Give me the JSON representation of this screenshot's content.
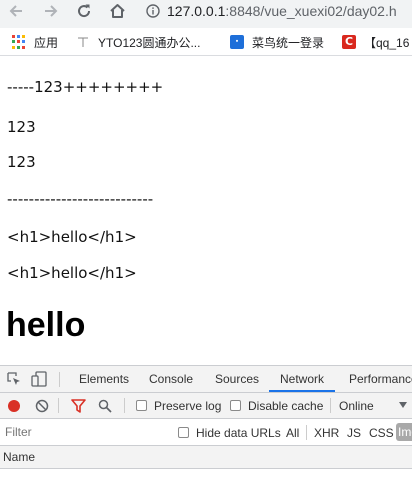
{
  "browser": {
    "url_host": "127.0.0.1",
    "url_path": ":8848/vue_xuexi02/day02.h",
    "bookmarks": [
      {
        "label": "应用",
        "icon": "apps-grid-icon"
      },
      {
        "label": "YTO123圆通办公...",
        "icon": "yto-icon"
      },
      {
        "label": "菜鸟统一登录",
        "icon": "cainiao-icon"
      },
      {
        "label": "【qq_16",
        "icon": "csdn-icon"
      }
    ]
  },
  "page": {
    "lines": [
      "-----123++++++++",
      "123",
      "123",
      "---------------------------",
      "<h1>hello</h1>",
      "<h1>hello</h1>"
    ],
    "heading": "hello"
  },
  "devtools": {
    "tabs": [
      "Elements",
      "Console",
      "Sources",
      "Network",
      "Performance"
    ],
    "active_tab": "Network",
    "toolbar": {
      "preserve_log": "Preserve log",
      "disable_cache": "Disable cache",
      "throttling": "Online"
    },
    "filter": {
      "placeholder": "Filter",
      "hide_data_urls": "Hide data URLs",
      "types": [
        "All",
        "XHR",
        "JS",
        "CSS",
        "Img"
      ]
    },
    "table": {
      "name_header": "Name"
    }
  },
  "colors": {
    "record_red": "#d93025",
    "filter_red": "#d93025",
    "active_tab_underline": "#1a73e8"
  }
}
